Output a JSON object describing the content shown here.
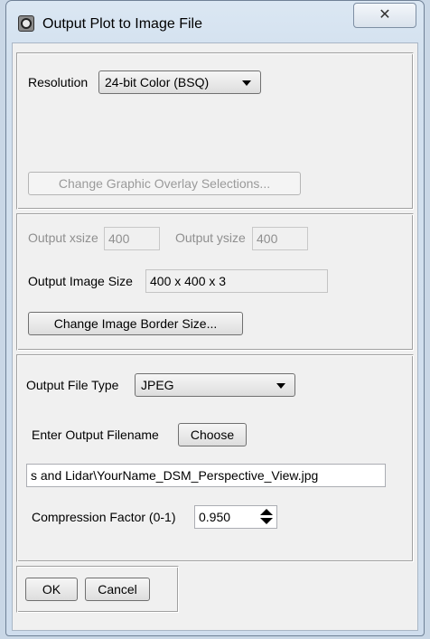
{
  "window": {
    "title": "Output Plot to Image File",
    "close_glyph": "✕"
  },
  "resolution": {
    "label": "Resolution",
    "selected": "24-bit Color (BSQ)",
    "overlay_button": "Change Graphic Overlay Selections..."
  },
  "size": {
    "xsize_label": "Output xsize",
    "xsize_value": "400",
    "ysize_label": "Output ysize",
    "ysize_value": "400",
    "image_size_label": "Output Image Size",
    "image_size_value": "400 x 400 x 3",
    "border_button": "Change Image Border Size..."
  },
  "output": {
    "file_type_label": "Output File Type",
    "file_type_selected": "JPEG",
    "filename_label": "Enter Output Filename",
    "choose_button": "Choose",
    "filename_value": "s and Lidar\\YourName_DSM_Perspective_View.jpg",
    "compression_label": "Compression Factor (0-1)",
    "compression_value": "0.950"
  },
  "footer": {
    "ok_label": "OK",
    "cancel_label": "Cancel"
  },
  "icons": {
    "app": "envi-app-icon",
    "close": "close-icon",
    "dropdown": "chevron-down-icon",
    "spinner": "spinner-arrows-icon"
  }
}
